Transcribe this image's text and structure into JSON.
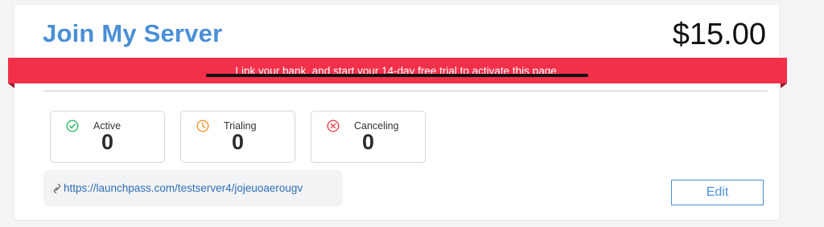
{
  "header": {
    "title": "Join My Server",
    "price": "$15.00"
  },
  "banner": {
    "text": "Link your bank, and start your 14-day free trial to activate this page.",
    "color": "#f2304a"
  },
  "stats": [
    {
      "label": "Active",
      "count": "0",
      "icon": "check-circle-icon",
      "color": "#27b66a"
    },
    {
      "label": "Trialing",
      "count": "0",
      "icon": "clock-icon",
      "color": "#f0932b"
    },
    {
      "label": "Canceling",
      "count": "0",
      "icon": "x-circle-icon",
      "color": "#e8414d"
    }
  ],
  "link": {
    "url": "https://launchpass.com/testserver4/jojeuoaerougv",
    "icon": "link-icon"
  },
  "actions": {
    "edit_label": "Edit"
  },
  "colors": {
    "accent": "#4a8fd6"
  }
}
